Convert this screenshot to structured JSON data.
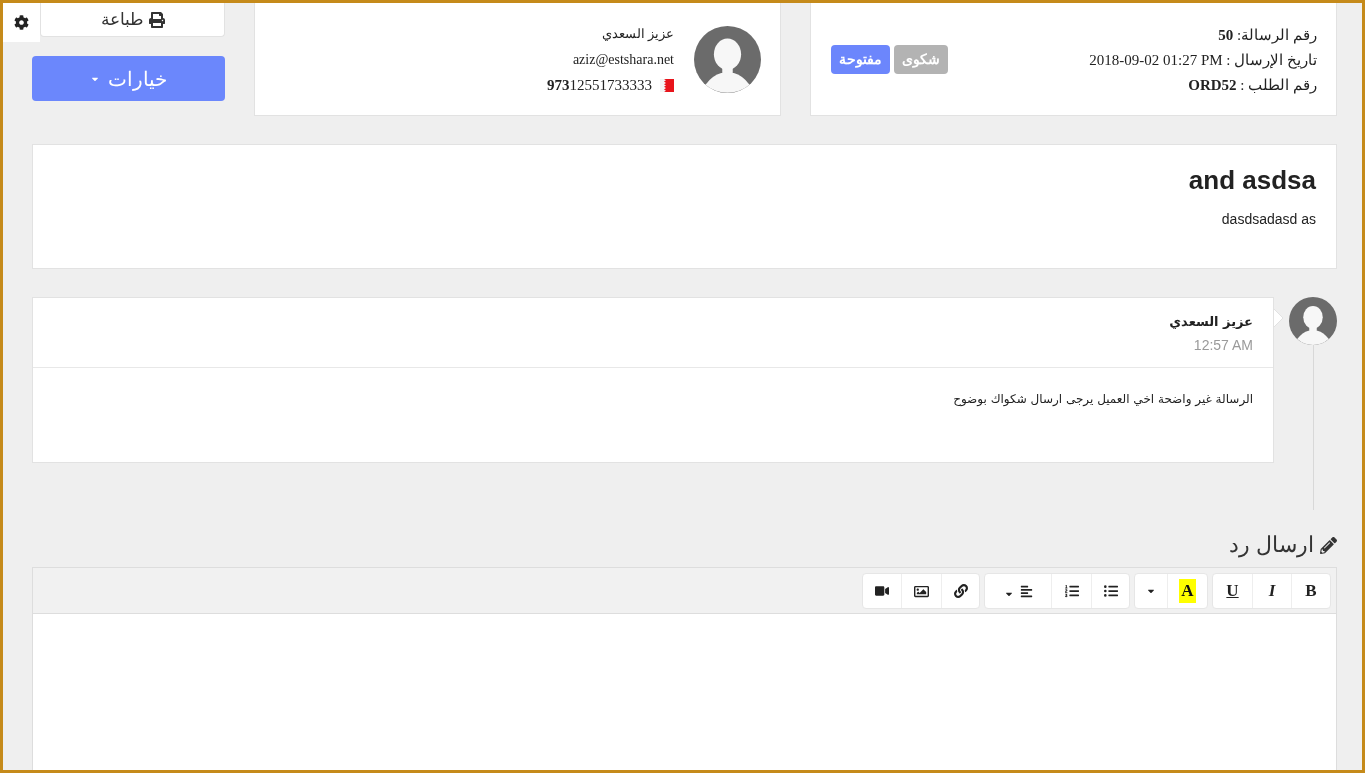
{
  "ticket": {
    "lines": [
      {
        "label": "رقم الرسالة:",
        "value": "**50**"
      },
      {
        "label": "تاريخ الإرسال :",
        "value": "2018-09-02 01:27 PM"
      },
      {
        "label": "رقم الطلب :",
        "value": "**ORD52**"
      }
    ],
    "tags": [
      {
        "label": "شكوى",
        "color": "#b3b3b3"
      },
      {
        "label": "مفتوحة",
        "color": "#6c86fc"
      }
    ]
  },
  "customer": {
    "name": "عزيز السعدي",
    "email": "aziz@estshara.net",
    "phone": "**973**12551733333"
  },
  "sidebar": {
    "print_button": "طباعة",
    "options_button": "خيارات"
  },
  "subject": {
    "title": "and asdsa",
    "body": "dasdsadasd as"
  },
  "comments": [
    {
      "author": "عزيز السعدي",
      "time": "12:57 AM",
      "text": "الرسالة غير واضحة اخي العميل يرجى ارسال شكواك بوضوح"
    }
  ],
  "reply": {
    "heading": "ارسال رد",
    "format_buttons": [
      {
        "kind": "bold",
        "label": "B"
      },
      {
        "kind": "italic",
        "label": "I"
      },
      {
        "kind": "underline",
        "label": "U"
      }
    ],
    "highlight_button": "A"
  }
}
